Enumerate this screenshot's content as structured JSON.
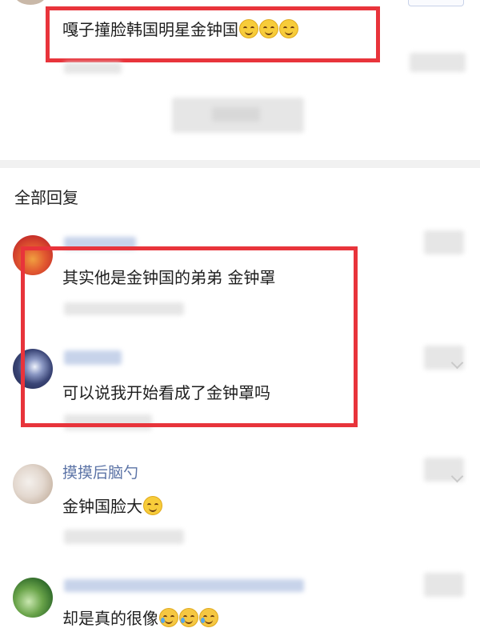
{
  "original_post": {
    "text": "嘎子撞脸韩国明星金钟国",
    "emoji": [
      "grin-emoji",
      "grin-emoji",
      "grin-emoji"
    ]
  },
  "section": {
    "title": "全部回复"
  },
  "replies": [
    {
      "username": "",
      "text": "其实他是金钟国的弟弟 金钟罩",
      "emoji": []
    },
    {
      "username": "",
      "text": "可以说我开始看成了金钟罩吗",
      "emoji": []
    },
    {
      "username": "摸摸后脑勺",
      "text": "金钟国脸大",
      "emoji": [
        "grin-emoji"
      ]
    },
    {
      "username": "",
      "text": "却是真的很像",
      "emoji": [
        "cry-laugh-emoji",
        "cry-laugh-emoji",
        "cry-laugh-emoji"
      ]
    }
  ],
  "colors": {
    "highlight_box": "#e8343b",
    "username": "#5b73a6",
    "divider": "#f1f1f1"
  }
}
